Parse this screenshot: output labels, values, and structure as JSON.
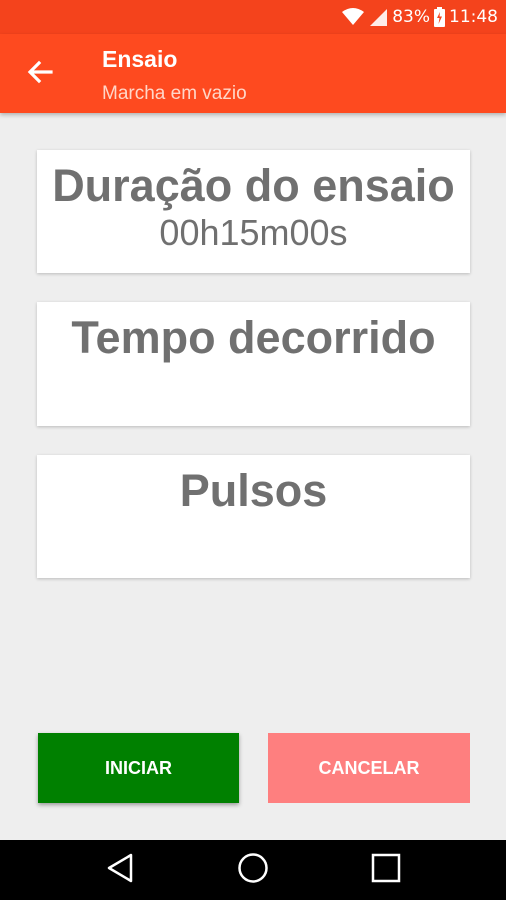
{
  "status_bar": {
    "battery_percent": "83%",
    "time": "11:48",
    "icons": [
      "wifi-icon",
      "signal-icon",
      "battery-charging-icon"
    ]
  },
  "app_bar": {
    "title": "Ensaio",
    "subtitle": "Marcha em vazio",
    "back_icon": "arrow-left-icon"
  },
  "cards": {
    "duration": {
      "title": "Duração do ensaio",
      "value": "00h15m00s"
    },
    "elapsed": {
      "title": "Tempo decorrido",
      "value": ""
    },
    "pulses": {
      "title": "Pulsos",
      "value": ""
    }
  },
  "buttons": {
    "start_label": "INICIAR",
    "cancel_label": "CANCELAR"
  },
  "nav_bar": {
    "icons": [
      "nav-back-icon",
      "nav-home-icon",
      "nav-recents-icon"
    ]
  },
  "colors": {
    "status_bar": "#f4431c",
    "app_bar": "#fe4a1f",
    "start_button": "#008000",
    "cancel_button": "#fe7f7f",
    "card_text": "#707070"
  }
}
